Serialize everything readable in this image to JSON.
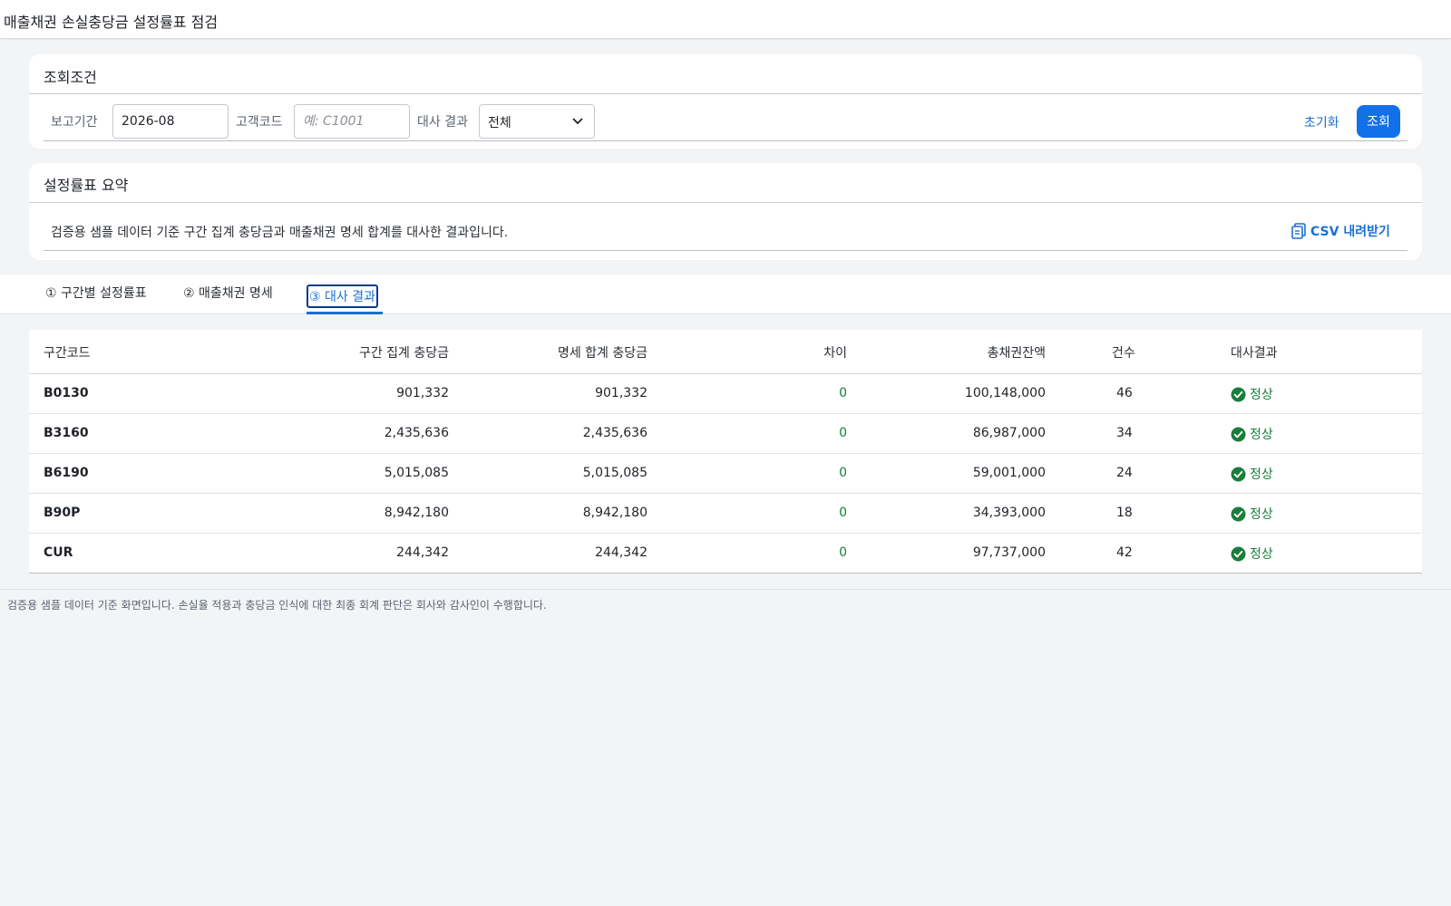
{
  "header": {
    "title": "매출채권 손실충당금 설정률표 점검"
  },
  "filter": {
    "title": "조회조건",
    "period_label": "보고기간",
    "period_value": "2026-08",
    "customer_label": "고객코드",
    "customer_placeholder": "예: C1001",
    "recon_label": "대사 결과",
    "recon_value": "전체",
    "reset_label": "초기화",
    "search_label": "조회"
  },
  "summary": {
    "title": "설정률표 요약",
    "text": "검증용 샘플 데이터 기준 구간 집계 충당금과 매출채권 명세 합계를 대사한 결과입니다.",
    "csv_label": "CSV 내려받기",
    "csv_icon": "file-download-icon"
  },
  "tabs": [
    {
      "label": "① 구간별 설정률표",
      "active": false
    },
    {
      "label": "② 매출채권 명세",
      "active": false
    },
    {
      "label": "③ 대사 결과",
      "active": true
    }
  ],
  "table": {
    "columns": [
      "구간코드",
      "구간 집계 충당금",
      "명세 합계 충당금",
      "차이",
      "총채권잔액",
      "건수",
      "대사결과"
    ],
    "rows": [
      {
        "code": "B0130",
        "bucket_allowance": "901,332",
        "detail_allowance": "901,332",
        "diff": "0",
        "balance": "100,148,000",
        "count": "46",
        "status": "정상"
      },
      {
        "code": "B3160",
        "bucket_allowance": "2,435,636",
        "detail_allowance": "2,435,636",
        "diff": "0",
        "balance": "86,987,000",
        "count": "34",
        "status": "정상"
      },
      {
        "code": "B6190",
        "bucket_allowance": "5,015,085",
        "detail_allowance": "5,015,085",
        "diff": "0",
        "balance": "59,001,000",
        "count": "24",
        "status": "정상"
      },
      {
        "code": "B90P",
        "bucket_allowance": "8,942,180",
        "detail_allowance": "8,942,180",
        "diff": "0",
        "balance": "34,393,000",
        "count": "18",
        "status": "정상"
      },
      {
        "code": "CUR",
        "bucket_allowance": "244,342",
        "detail_allowance": "244,342",
        "diff": "0",
        "balance": "97,737,000",
        "count": "42",
        "status": "정상"
      }
    ],
    "status_icon": "check-circle-icon",
    "status_color": "#1a7d3a"
  },
  "footer": {
    "note": "검증용 샘플 데이터 기준 화면입니다. 손실율 적용과 충당금 인식에 대한 최종 회계 판단은 회사와 감사인이 수행합니다."
  },
  "colors": {
    "accent": "#1170ea",
    "link": "#1a6fd6",
    "ok": "#1a7d3a"
  }
}
